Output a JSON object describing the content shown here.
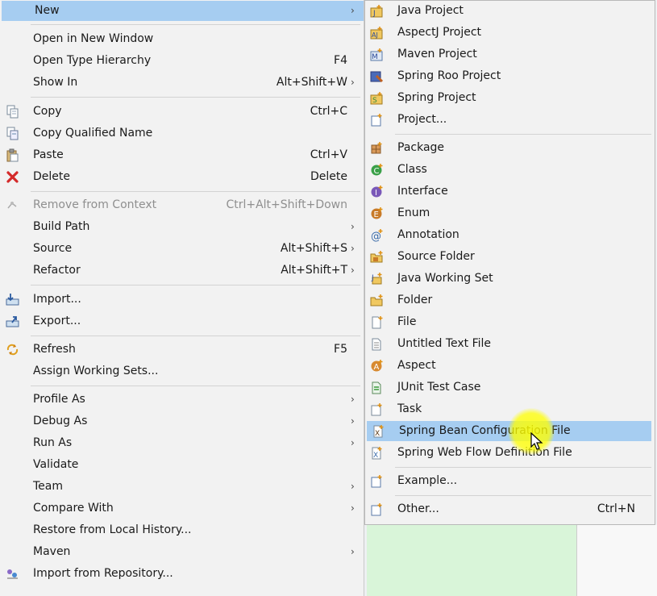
{
  "main_menu": {
    "items": [
      {
        "label": "New",
        "shortcut": "",
        "submenu": true,
        "icon": "",
        "highlighted": true
      },
      {
        "label": "Open in New Window",
        "shortcut": "",
        "icon": ""
      },
      {
        "label": "Open Type Hierarchy",
        "shortcut": "F4",
        "icon": ""
      },
      {
        "label": "Show In",
        "shortcut": "Alt+Shift+W",
        "submenu": true,
        "icon": ""
      },
      {
        "label": "Copy",
        "shortcut": "Ctrl+C",
        "icon": "copy-icon"
      },
      {
        "label": "Copy Qualified Name",
        "shortcut": "",
        "icon": "copy-qualified-icon"
      },
      {
        "label": "Paste",
        "shortcut": "Ctrl+V",
        "icon": "paste-icon"
      },
      {
        "label": "Delete",
        "shortcut": "Delete",
        "icon": "delete-icon"
      },
      {
        "label": "Remove from Context",
        "shortcut": "Ctrl+Alt+Shift+Down",
        "icon": "remove-context-icon",
        "disabled": true
      },
      {
        "label": "Build Path",
        "shortcut": "",
        "submenu": true,
        "icon": ""
      },
      {
        "label": "Source",
        "shortcut": "Alt+Shift+S",
        "submenu": true,
        "icon": ""
      },
      {
        "label": "Refactor",
        "shortcut": "Alt+Shift+T",
        "submenu": true,
        "icon": ""
      },
      {
        "label": "Import...",
        "shortcut": "",
        "icon": "import-icon"
      },
      {
        "label": "Export...",
        "shortcut": "",
        "icon": "export-icon"
      },
      {
        "label": "Refresh",
        "shortcut": "F5",
        "icon": "refresh-icon"
      },
      {
        "label": "Assign Working Sets...",
        "shortcut": "",
        "icon": ""
      },
      {
        "label": "Profile As",
        "shortcut": "",
        "submenu": true,
        "icon": ""
      },
      {
        "label": "Debug As",
        "shortcut": "",
        "submenu": true,
        "icon": ""
      },
      {
        "label": "Run As",
        "shortcut": "",
        "submenu": true,
        "icon": ""
      },
      {
        "label": "Validate",
        "shortcut": "",
        "icon": ""
      },
      {
        "label": "Team",
        "shortcut": "",
        "submenu": true,
        "icon": ""
      },
      {
        "label": "Compare With",
        "shortcut": "",
        "submenu": true,
        "icon": ""
      },
      {
        "label": "Restore from Local History...",
        "shortcut": "",
        "icon": ""
      },
      {
        "label": "Maven",
        "shortcut": "",
        "submenu": true,
        "icon": ""
      },
      {
        "label": "Import from Repository...",
        "shortcut": "",
        "icon": "import-repository-icon"
      }
    ]
  },
  "new_submenu": {
    "items": [
      {
        "label": "Java Project",
        "shortcut": "",
        "icon": "java-project-icon"
      },
      {
        "label": "AspectJ Project",
        "shortcut": "",
        "icon": "aspectj-project-icon"
      },
      {
        "label": "Maven Project",
        "shortcut": "",
        "icon": "maven-project-icon"
      },
      {
        "label": "Spring Roo Project",
        "shortcut": "",
        "icon": "spring-roo-project-icon"
      },
      {
        "label": "Spring Project",
        "shortcut": "",
        "icon": "spring-project-icon"
      },
      {
        "label": "Project...",
        "shortcut": "",
        "icon": "project-icon"
      },
      {
        "label": "Package",
        "shortcut": "",
        "icon": "package-icon"
      },
      {
        "label": "Class",
        "shortcut": "",
        "icon": "class-icon"
      },
      {
        "label": "Interface",
        "shortcut": "",
        "icon": "interface-icon"
      },
      {
        "label": "Enum",
        "shortcut": "",
        "icon": "enum-icon"
      },
      {
        "label": "Annotation",
        "shortcut": "",
        "icon": "annotation-icon"
      },
      {
        "label": "Source Folder",
        "shortcut": "",
        "icon": "source-folder-icon"
      },
      {
        "label": "Java Working Set",
        "shortcut": "",
        "icon": "java-working-set-icon"
      },
      {
        "label": "Folder",
        "shortcut": "",
        "icon": "folder-icon"
      },
      {
        "label": "File",
        "shortcut": "",
        "icon": "file-icon"
      },
      {
        "label": "Untitled Text File",
        "shortcut": "",
        "icon": "text-file-icon"
      },
      {
        "label": "Aspect",
        "shortcut": "",
        "icon": "aspect-icon"
      },
      {
        "label": "JUnit Test Case",
        "shortcut": "",
        "icon": "junit-test-case-icon"
      },
      {
        "label": "Task",
        "shortcut": "",
        "icon": "task-icon"
      },
      {
        "label": "Spring Bean Configuration File",
        "shortcut": "",
        "icon": "spring-bean-config-icon",
        "highlighted": true
      },
      {
        "label": "Spring Web Flow Definition File",
        "shortcut": "",
        "icon": "spring-webflow-icon"
      },
      {
        "label": "Example...",
        "shortcut": "",
        "icon": "example-icon"
      },
      {
        "label": "Other...",
        "shortcut": "Ctrl+N",
        "icon": "other-icon"
      }
    ]
  },
  "colors": {
    "highlight": "#a6cdf1",
    "menu_bg": "#f2f2f2",
    "separator": "#d3d3d3",
    "disabled_text": "#8f8f8f",
    "cursor_halo": "#ffff00"
  }
}
